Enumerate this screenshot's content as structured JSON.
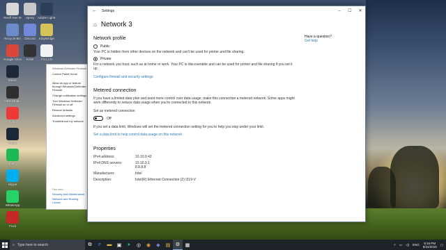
{
  "desktop": {
    "icons": [
      {
        "label": "Geoff Gee MR Scans",
        "color": "#d8d8d8"
      },
      {
        "label": "Upsey",
        "color": "#c8c8c8"
      },
      {
        "label": "Adobe Lightroom",
        "color": "#2c3e58"
      },
      {
        "label": "Recycle Bin",
        "color": "#6b8cc8"
      },
      {
        "label": "Discord",
        "color": "#7289da"
      },
      {
        "label": "KittyBridge",
        "color": "#d6c25a"
      },
      {
        "label": "Google Chrome",
        "color": "#d9473b"
      },
      {
        "label": "KAW",
        "color": "#333"
      },
      {
        "label": "FX.LAN",
        "color": "#f2f2f2"
      },
      {
        "label": "Steam",
        "color": "#1b2838"
      },
      {
        "label": "OBS Studio",
        "color": "#2f2f2f"
      },
      {
        "label": "Vivaldi",
        "color": "#ef3939"
      },
      {
        "label": "Steam",
        "color": "#1b2838"
      },
      {
        "label": "Spotify",
        "color": "#1db954"
      },
      {
        "label": "Skype",
        "color": "#00aff0"
      },
      {
        "label": "WhatsApp",
        "color": "#25d366"
      },
      {
        "label": "Foxit",
        "color": "#c62828"
      }
    ]
  },
  "control_panel": {
    "title": "Windows Defender Firewall",
    "items": [
      {
        "label": "Control Panel Home",
        "link": false
      },
      {
        "label": "Allow an app or feature through Windows Defender Firewall",
        "link": false
      },
      {
        "label": "Change notification settings",
        "link": false
      },
      {
        "label": "Turn Windows Defender Firewall on or off",
        "link": false
      },
      {
        "label": "Restore defaults",
        "link": false
      },
      {
        "label": "Advanced settings",
        "link": false
      },
      {
        "label": "Troubleshoot my network",
        "link": false
      }
    ],
    "see_also": "See also",
    "see_also_items": [
      "Security and Maintenance",
      "Network and Sharing Center"
    ]
  },
  "settings": {
    "window_title": "Settings",
    "page_title": "Network 3",
    "network_profile": {
      "heading": "Network profile",
      "public_label": "Public",
      "public_desc": "Your PC is hidden from other devices on the network and can't be used for printer and file sharing.",
      "private_label": "Private",
      "private_desc": "For a network you trust, such as at home or work. Your PC is discoverable and can be used for printer and file sharing if you set it up.",
      "selected": "Private",
      "configure_link": "Configure firewall and security settings"
    },
    "metered": {
      "heading": "Metered connection",
      "desc": "If you have a limited data plan and want more control over data usage, make this connection a metered network. Some apps might work differently to reduce data usage when you're connected to this network.",
      "toggle_caption": "Set as metered connection",
      "toggle_state": "Off",
      "limit_desc": "If you set a data limit, Windows will set the metered connection setting for you to help you stay under your limit.",
      "limit_link": "Set a data limit to help control data usage on this network"
    },
    "properties": {
      "heading": "Properties",
      "rows": [
        {
          "k": "IPv4 address:",
          "v": "10.10.0.42"
        },
        {
          "k": "IPv4 DNS servers:",
          "v": "10.10.0.1\n8.8.8.8"
        },
        {
          "k": "Manufacturer:",
          "v": "Intel"
        },
        {
          "k": "Description:",
          "v": "Intel(R) Ethernet Connection (2) I219-V"
        }
      ]
    },
    "side": {
      "question": "Have a question?",
      "help": "Get help"
    }
  },
  "taskbar": {
    "search_placeholder": "Type here to search",
    "time": "8:16 PM",
    "date": "8/24/2018",
    "lang": "ENG"
  }
}
